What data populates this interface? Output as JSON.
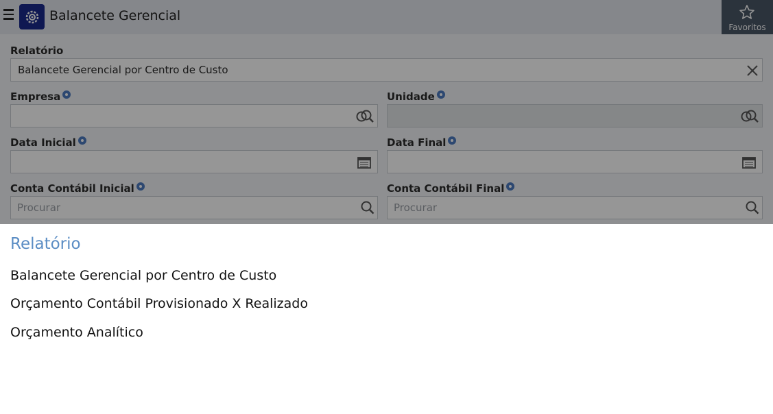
{
  "header": {
    "title": "Balancete Gerencial",
    "favorites_label": "Favoritos"
  },
  "form": {
    "relatorio": {
      "label": "Relatório",
      "value": "Balancete Gerencial por Centro de Custo"
    },
    "empresa": {
      "label": "Empresa",
      "value": ""
    },
    "unidade": {
      "label": "Unidade",
      "value": ""
    },
    "data_inicial": {
      "label": "Data Inicial",
      "value": ""
    },
    "data_final": {
      "label": "Data Final",
      "value": ""
    },
    "conta_inicial": {
      "label": "Conta Contábil Inicial",
      "placeholder": "Procurar"
    },
    "conta_final": {
      "label": "Conta Contábil Final",
      "placeholder": "Procurar"
    }
  },
  "picker": {
    "title": "Relatório",
    "options": [
      "Balancete Gerencial por Centro de Custo",
      "Orçamento Contábil Provisionado X Realizado",
      "Orçamento Analítico"
    ]
  },
  "colors": {
    "header_bg": "#e3e6ec",
    "favorites_bg": "#4a5766",
    "logo_bg": "#1a2a8c",
    "picker_title": "#5b8dc4",
    "info_icon": "#4d7bc0"
  }
}
